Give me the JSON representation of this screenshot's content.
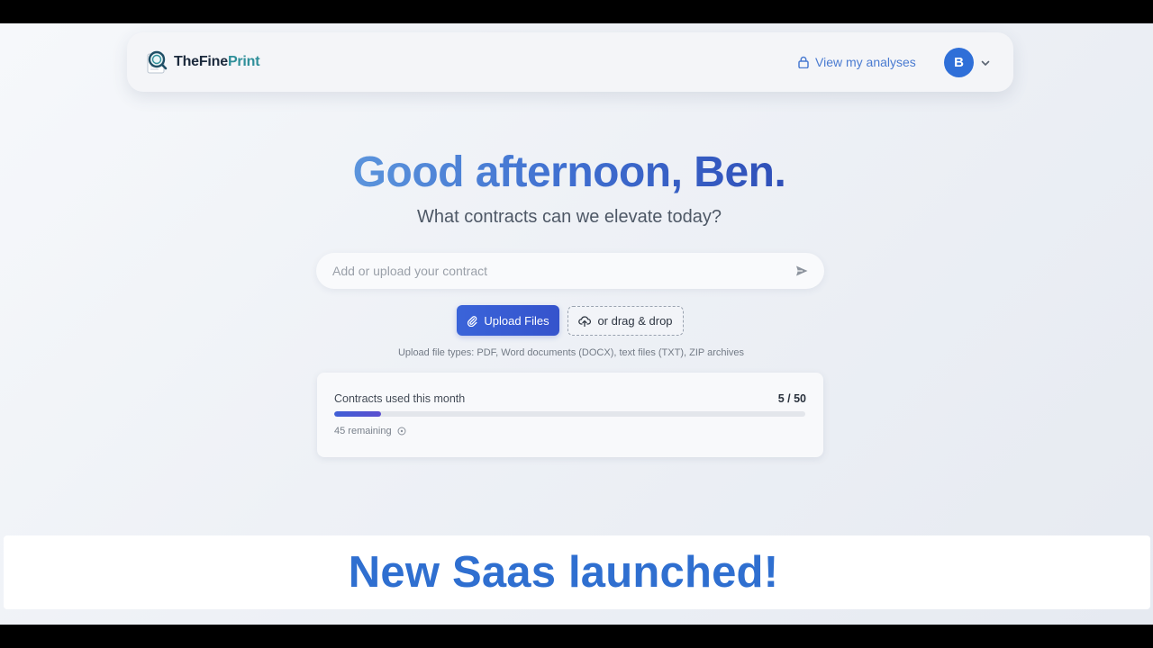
{
  "app": {
    "brand_part1": "TheFine",
    "brand_part2": "Print"
  },
  "navbar": {
    "view_analyses_label": "View my analyses",
    "avatar_initial": "B"
  },
  "hero": {
    "greeting": "Good afternoon, Ben.",
    "subtitle": "What contracts can we elevate today?"
  },
  "contract_input": {
    "placeholder": "Add or upload your contract",
    "value": ""
  },
  "upload": {
    "upload_button_label": "Upload Files",
    "drag_drop_label": "or drag & drop",
    "file_types_text": "Upload file types: PDF, Word documents (DOCX), text files (TXT), ZIP archives"
  },
  "usage": {
    "label": "Contracts used this month",
    "count_text": "5 / 50",
    "used": 5,
    "limit": 50,
    "progress_fraction": 0.1,
    "remaining_text": "45 remaining"
  },
  "banner": {
    "text": "New Saas launched!"
  },
  "colors": {
    "brand_blue": "#2f6fd8",
    "banner_text": "#2f6fd0",
    "upload_button": "#3a64d9",
    "link": "#4a7bd1"
  },
  "icons": [
    "logo-magnifier-icon",
    "lock-icon",
    "chevron-down-icon",
    "send-icon",
    "paperclip-icon",
    "cloud-upload-icon",
    "info-icon"
  ]
}
